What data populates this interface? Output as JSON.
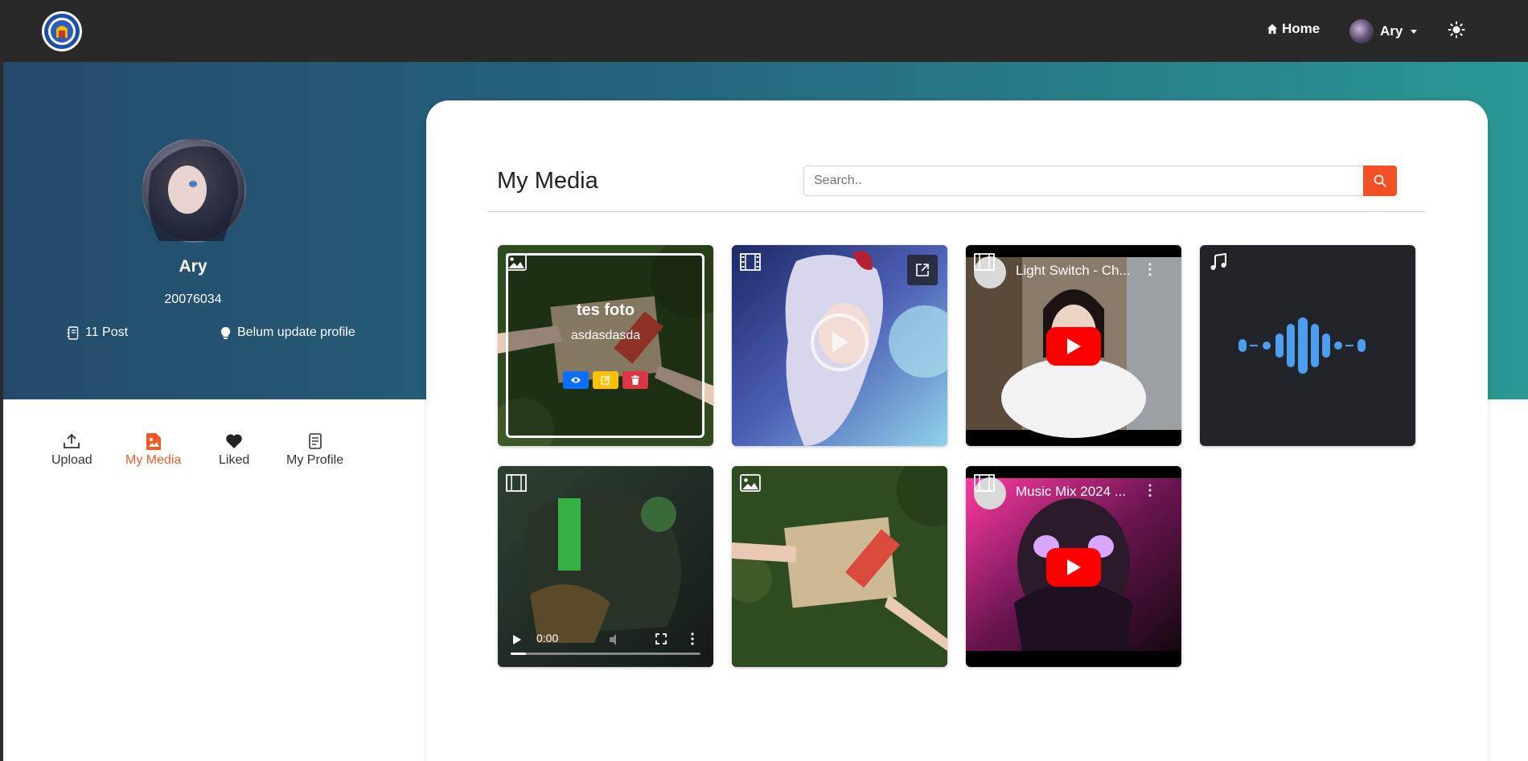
{
  "navbar": {
    "home_label": "Home",
    "user_name": "Ary",
    "icons": {
      "home": "house-icon",
      "theme": "sun-icon",
      "logo": "institution-logo"
    }
  },
  "profile": {
    "name": "Ary",
    "id": "20076034",
    "post_count": "11 Post",
    "status": "Belum update profile"
  },
  "tabs": [
    {
      "label": "Upload",
      "icon": "upload-icon",
      "active": false
    },
    {
      "label": "My Media",
      "icon": "image-file-icon",
      "active": true
    },
    {
      "label": "Liked",
      "icon": "heart-icon",
      "active": false
    },
    {
      "label": "My Profile",
      "icon": "document-icon",
      "active": false
    }
  ],
  "main": {
    "title": "My Media",
    "search_placeholder": "Search.."
  },
  "media": [
    {
      "type": "image",
      "title": "tes foto",
      "description": "asdasdasda",
      "hovered": true
    },
    {
      "type": "video",
      "external": true
    },
    {
      "type": "youtube",
      "title": "Light Switch - Ch..."
    },
    {
      "type": "audio"
    },
    {
      "type": "video",
      "time": "0:00"
    },
    {
      "type": "image"
    },
    {
      "type": "youtube",
      "title": "Music Mix 2024 ..."
    }
  ],
  "colors": {
    "accent": "#f24f24",
    "navbar": "#292929",
    "hero_start": "#234a6b",
    "hero_end": "#2a9893"
  }
}
